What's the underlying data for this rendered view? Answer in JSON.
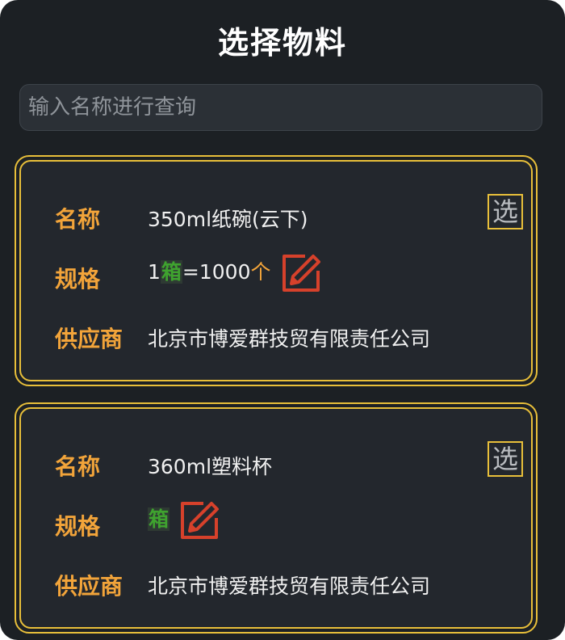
{
  "title": "选择物料",
  "search": {
    "placeholder": "输入名称进行查询"
  },
  "labels": {
    "name": "名称",
    "spec": "规格",
    "supplier": "供应商"
  },
  "select_label": "选",
  "items": [
    {
      "name": "350ml纸碗(云下)",
      "spec_prefix": "1",
      "spec_unit": "箱",
      "spec_eq": "=1000",
      "spec_count_unit": "个",
      "supplier": "北京市博爱群技贸有限责任公司"
    },
    {
      "name": "360ml塑料杯",
      "spec_prefix": "",
      "spec_unit": "箱",
      "spec_eq": "",
      "spec_count_unit": "",
      "supplier": "北京市博爱群技贸有限责任公司"
    }
  ],
  "colors": {
    "accent": "#e8bf3a",
    "label": "#f2a43a",
    "unit": "#3fa32f",
    "edit": "#d6412b"
  },
  "icons": {
    "edit": "edit-square-icon"
  }
}
